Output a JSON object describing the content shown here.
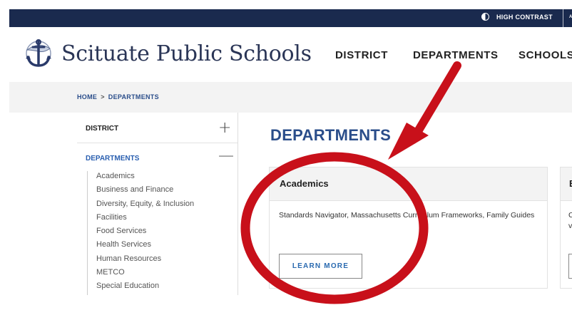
{
  "utility": {
    "high_contrast_label": "HIGH CONTRAST",
    "truncated_link": "A"
  },
  "header": {
    "site_name": "Scituate Public Schools",
    "nav": [
      "DISTRICT",
      "DEPARTMENTS",
      "SCHOOLS"
    ]
  },
  "breadcrumb": {
    "home": "HOME",
    "separator": ">",
    "current": "DEPARTMENTS"
  },
  "sidebar": {
    "sections": [
      {
        "label": "DISTRICT",
        "toggle": "+"
      },
      {
        "label": "DEPARTMENTS",
        "toggle": "—"
      }
    ],
    "items": [
      "Academics",
      "Business and Finance",
      "Diversity, Equity, & Inclusion",
      "Facilities",
      "Food Services",
      "Health Services",
      "Human Resources",
      "METCO",
      "Special Education"
    ]
  },
  "main": {
    "title": "DEPARTMENTS",
    "cards": [
      {
        "title": "Academics",
        "description": "Standards Navigator, Massachusetts Curriculum Frameworks, Family Guides",
        "button": "LEARN MORE"
      },
      {
        "title": "B",
        "description_lines": [
          "C",
          "v"
        ]
      }
    ]
  },
  "colors": {
    "topbar": "#1a2a4e",
    "brand_blue": "#2a4d8a",
    "annotation_red": "#c8101a"
  }
}
